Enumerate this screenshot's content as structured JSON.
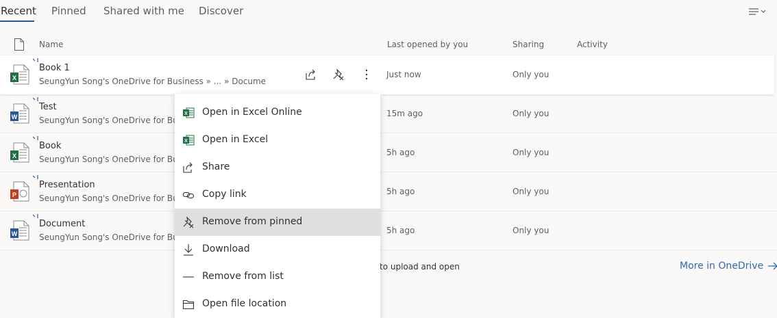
{
  "tabs": [
    {
      "label": "Recent",
      "active": true
    },
    {
      "label": "Pinned",
      "active": false
    },
    {
      "label": "Shared with me",
      "active": false
    },
    {
      "label": "Discover",
      "active": false
    }
  ],
  "header": {
    "name": "Name",
    "last_opened": "Last opened by you",
    "sharing": "Sharing",
    "activity": "Activity"
  },
  "files": [
    {
      "name": "Book 1",
      "path": "SeungYun Song's OneDrive for Business » ... » Documents",
      "last_opened": "Just now",
      "sharing": "Only you",
      "type": "excel"
    },
    {
      "name": "Test",
      "path": "SeungYun Song's OneDrive for Business",
      "last_opened": "15m ago",
      "sharing": "Only you",
      "type": "word"
    },
    {
      "name": "Book",
      "path": "SeungYun Song's OneDrive for Business",
      "last_opened": "5h ago",
      "sharing": "Only you",
      "type": "excel"
    },
    {
      "name": "Presentation",
      "path": "SeungYun Song's OneDrive for Business",
      "last_opened": "5h ago",
      "sharing": "Only you",
      "type": "powerpoint"
    },
    {
      "name": "Document",
      "path": "SeungYun Song's OneDrive for Business",
      "last_opened": "5h ago",
      "sharing": "Only you",
      "type": "word"
    }
  ],
  "footer": {
    "upload_text": "to upload and open",
    "more_link": "More in OneDrive"
  },
  "context_menu": {
    "items": [
      {
        "label": "Open in Excel Online",
        "icon": "excel-icon"
      },
      {
        "label": "Open in Excel",
        "icon": "excel-icon"
      },
      {
        "label": "Share",
        "icon": "share-icon"
      },
      {
        "label": "Copy link",
        "icon": "link-icon"
      },
      {
        "label": "Remove from pinned",
        "icon": "unpin-icon",
        "hover": true
      },
      {
        "label": "Download",
        "icon": "download-icon"
      },
      {
        "label": "Remove from list",
        "icon": "dash-icon"
      },
      {
        "label": "Open file location",
        "icon": "folder-icon"
      }
    ]
  },
  "colors": {
    "excel": "#1e7145",
    "word": "#2b579a",
    "powerpoint": "#c43e1c",
    "accent": "#2b579a",
    "link": "#2b6cb8"
  }
}
